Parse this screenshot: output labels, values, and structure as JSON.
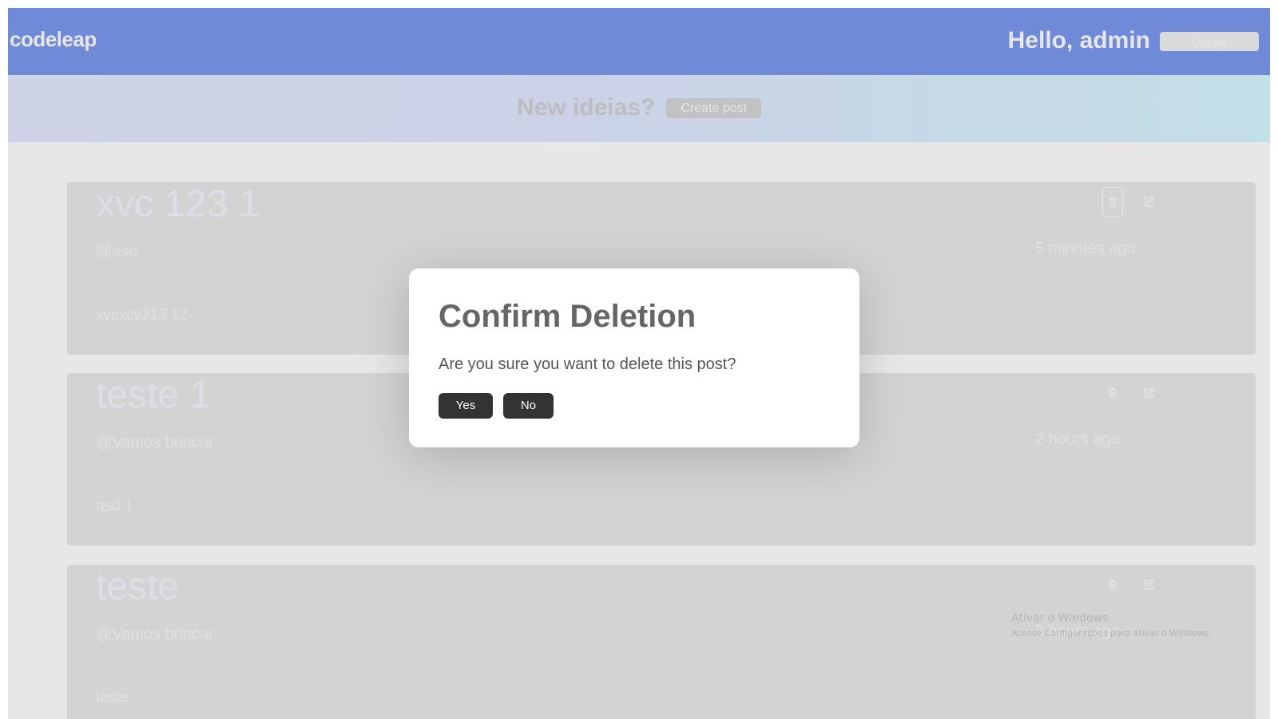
{
  "header": {
    "logo": "codeleap",
    "greeting": "Hello, admin",
    "logout_label": "Logout"
  },
  "band": {
    "title": "New ideias?",
    "create_label": "Create post"
  },
  "posts": [
    {
      "title": "xvc 123 1",
      "user": "@asd",
      "time": "5 minutes ago",
      "body": "xvcxcv213 12"
    },
    {
      "title": "teste 1",
      "user": "@Vamos brincar",
      "time": "2 hours ago",
      "body": "asd 1"
    },
    {
      "title": "teste",
      "user": "@Vamos brincar",
      "time": "2 hours ago",
      "body": "teste"
    }
  ],
  "modal": {
    "title": "Confirm Deletion",
    "message": "Are you sure you want to delete this post?",
    "yes_label": "Yes",
    "no_label": "No"
  },
  "watermark": {
    "title": "Ativar o Windows",
    "subtitle": "Acesse Configurações para ativar o Windows."
  },
  "colors": {
    "header_bg": "#7695ec",
    "modal_button_bg": "#333333",
    "overlay": "rgba(70,70,70,0.13)"
  }
}
